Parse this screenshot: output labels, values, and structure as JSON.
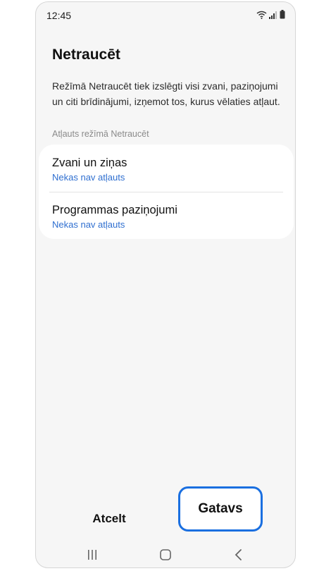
{
  "status_bar": {
    "time": "12:45",
    "icons": [
      "wifi-icon",
      "signal-icon",
      "battery-icon"
    ]
  },
  "page": {
    "title": "Netraucēt",
    "description": "Režīmā Netraucēt tiek izslēgti visi zvani, paziņojumi un citi brīdinājumi, izņemot tos, kurus vēlaties atļaut.",
    "section_label": "Atļauts režīmā Netraucēt"
  },
  "settings": [
    {
      "title": "Zvani un ziņas",
      "subtitle": "Nekas nav atļauts"
    },
    {
      "title": "Programmas paziņojumi",
      "subtitle": "Nekas nav atļauts"
    }
  ],
  "actions": {
    "cancel_label": "Atcelt",
    "done_label": "Gatavs"
  },
  "colors": {
    "accent": "#2f6fd0",
    "highlight_border": "#1a6fe0",
    "background": "#f6f6f6"
  },
  "nav_bar": {
    "icons": [
      "recent-apps-icon",
      "home-icon",
      "back-icon"
    ]
  }
}
